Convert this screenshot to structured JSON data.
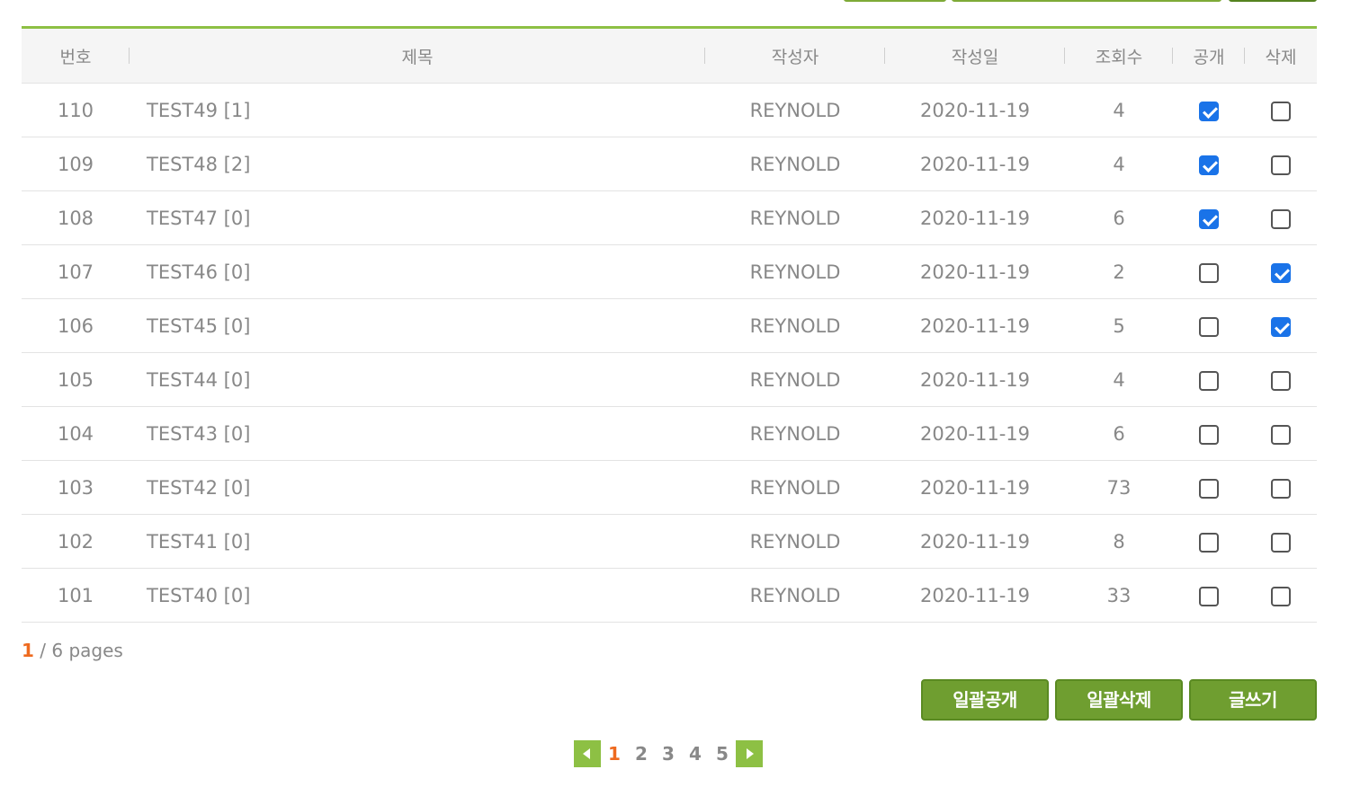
{
  "table": {
    "headers": {
      "no": "번호",
      "title": "제목",
      "author": "작성자",
      "date": "작성일",
      "views": "조회수",
      "public": "공개",
      "delete": "삭제"
    },
    "rows": [
      {
        "no": "110",
        "title": "TEST49 [1]",
        "author": "REYNOLD",
        "date": "2020-11-19",
        "views": "4",
        "public": true,
        "delete": false
      },
      {
        "no": "109",
        "title": "TEST48 [2]",
        "author": "REYNOLD",
        "date": "2020-11-19",
        "views": "4",
        "public": true,
        "delete": false
      },
      {
        "no": "108",
        "title": "TEST47 [0]",
        "author": "REYNOLD",
        "date": "2020-11-19",
        "views": "6",
        "public": true,
        "delete": false
      },
      {
        "no": "107",
        "title": "TEST46 [0]",
        "author": "REYNOLD",
        "date": "2020-11-19",
        "views": "2",
        "public": false,
        "delete": true
      },
      {
        "no": "106",
        "title": "TEST45 [0]",
        "author": "REYNOLD",
        "date": "2020-11-19",
        "views": "5",
        "public": false,
        "delete": true
      },
      {
        "no": "105",
        "title": "TEST44 [0]",
        "author": "REYNOLD",
        "date": "2020-11-19",
        "views": "4",
        "public": false,
        "delete": false
      },
      {
        "no": "104",
        "title": "TEST43 [0]",
        "author": "REYNOLD",
        "date": "2020-11-19",
        "views": "6",
        "public": false,
        "delete": false
      },
      {
        "no": "103",
        "title": "TEST42 [0]",
        "author": "REYNOLD",
        "date": "2020-11-19",
        "views": "73",
        "public": false,
        "delete": false
      },
      {
        "no": "102",
        "title": "TEST41 [0]",
        "author": "REYNOLD",
        "date": "2020-11-19",
        "views": "8",
        "public": false,
        "delete": false
      },
      {
        "no": "101",
        "title": "TEST40 [0]",
        "author": "REYNOLD",
        "date": "2020-11-19",
        "views": "33",
        "public": false,
        "delete": false
      }
    ]
  },
  "page_info": {
    "current": "1",
    "rest": " / 6 pages"
  },
  "actions": {
    "bulk_public": "일괄공개",
    "bulk_delete": "일괄삭제",
    "write": "글쓰기"
  },
  "pagination": {
    "pages": [
      "1",
      "2",
      "3",
      "4",
      "5"
    ],
    "active": "1"
  },
  "colors": {
    "accent_green": "#8dc044",
    "button_green": "#6f9e30",
    "active_page": "#ee6a1f",
    "checkbox_checked": "#1a73e8"
  }
}
